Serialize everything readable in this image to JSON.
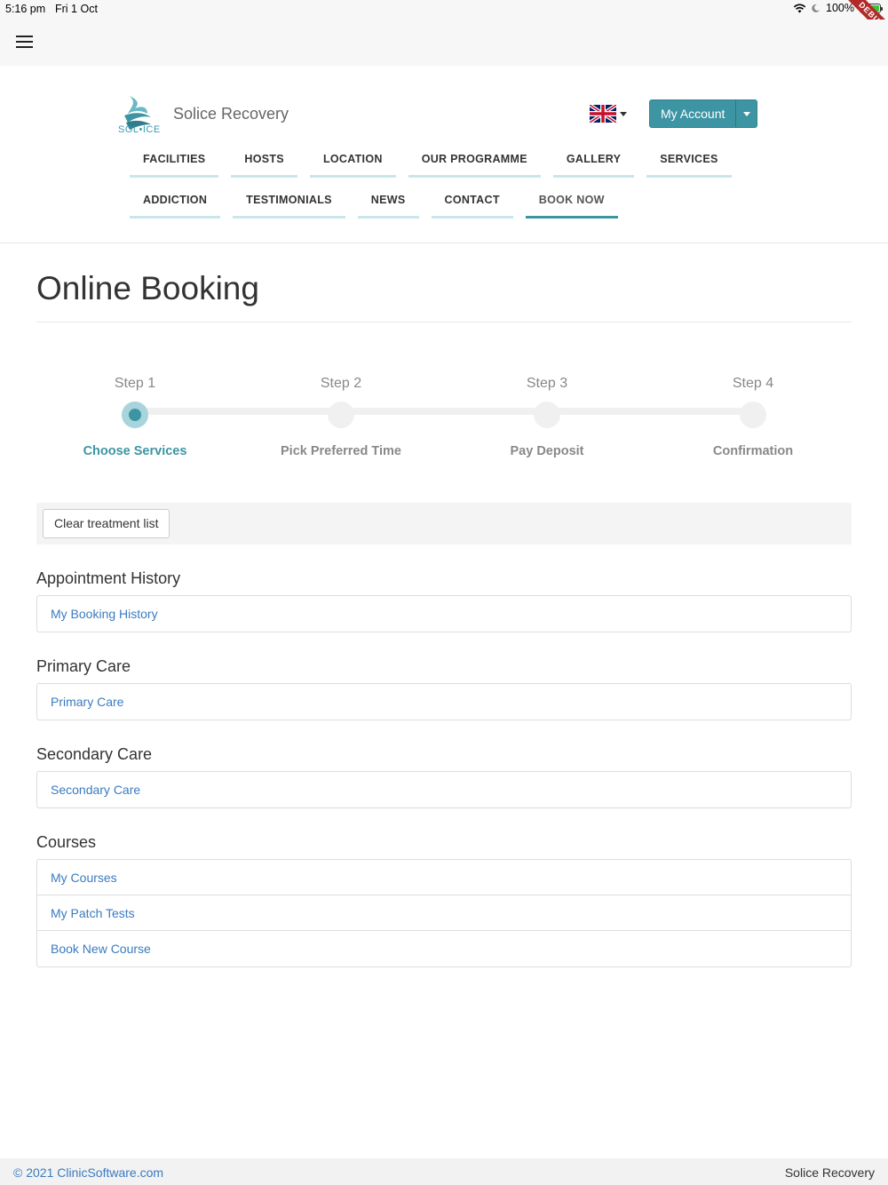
{
  "status_bar": {
    "time": "5:16 pm",
    "date": "Fri 1 Oct",
    "battery": "100%",
    "debug_label": "DEBUG"
  },
  "app_bar": {
    "menu_icon": "hamburger-menu-icon"
  },
  "header": {
    "logo_text": "SOL•ICE",
    "brand": "Solice Recovery",
    "language_flag": "uk-flag-icon",
    "account_button": "My Account",
    "accent_color": "#3d95a3"
  },
  "nav": {
    "row1": [
      "FACILITIES",
      "HOSTS",
      "LOCATION",
      "OUR PROGRAMME",
      "GALLERY",
      "SERVICES"
    ],
    "row2": [
      "ADDICTION",
      "TESTIMONIALS",
      "NEWS",
      "CONTACT",
      "BOOK NOW"
    ],
    "active": "BOOK NOW"
  },
  "page": {
    "title": "Online Booking"
  },
  "stepper": {
    "steps": [
      {
        "num": "Step 1",
        "name": "Choose Services"
      },
      {
        "num": "Step 2",
        "name": "Pick Preferred Time"
      },
      {
        "num": "Step 3",
        "name": "Pay Deposit"
      },
      {
        "num": "Step 4",
        "name": "Confirmation"
      }
    ],
    "active_step": 1
  },
  "toolbar": {
    "clear_button": "Clear treatment list"
  },
  "sections": {
    "appointment_history": {
      "title": "Appointment History",
      "items": [
        "My Booking History"
      ]
    },
    "primary_care": {
      "title": "Primary Care",
      "items": [
        "Primary Care"
      ]
    },
    "secondary_care": {
      "title": "Secondary Care",
      "items": [
        "Secondary Care"
      ]
    },
    "courses": {
      "title": "Courses",
      "items": [
        "My Courses",
        "My Patch Tests",
        "Book New Course"
      ]
    }
  },
  "footer": {
    "copyright": "© 2021 ClinicSoftware.com",
    "brand": "Solice Recovery"
  }
}
